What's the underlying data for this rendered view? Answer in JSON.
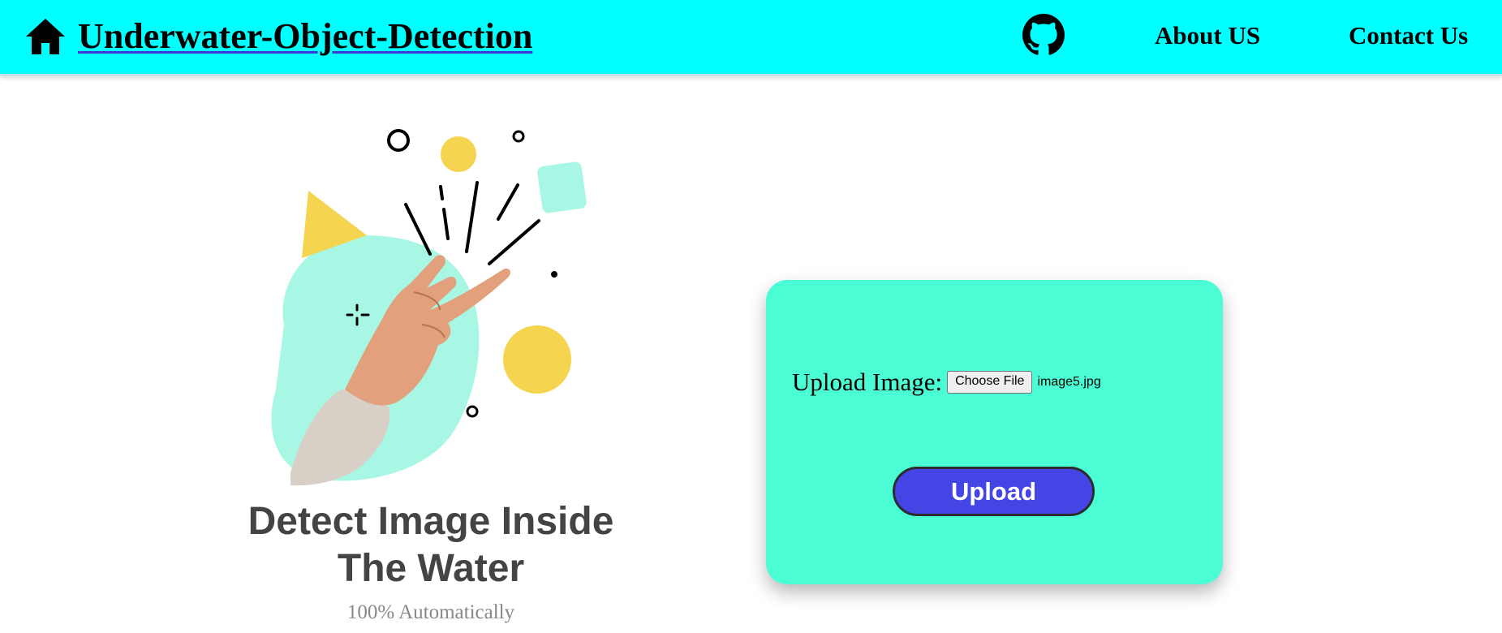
{
  "navbar": {
    "title": "Underwater-Object-Detection",
    "home_icon": "home-icon",
    "github_icon": "github-icon",
    "links": [
      {
        "label": "About US"
      },
      {
        "label": "Contact Us"
      }
    ],
    "background": "#00ffff"
  },
  "hero": {
    "title_line1": "Detect Image Inside",
    "title_line2": "The Water",
    "subtitle": "100% Automatically",
    "illustration": "snapping-hand-illustration"
  },
  "upload_card": {
    "label": "Upload Image:",
    "choose_file_label": "Choose File",
    "selected_file": "image5.jpg",
    "submit_label": "Upload",
    "background": "#4afdd4",
    "button_color": "#4545e6"
  }
}
